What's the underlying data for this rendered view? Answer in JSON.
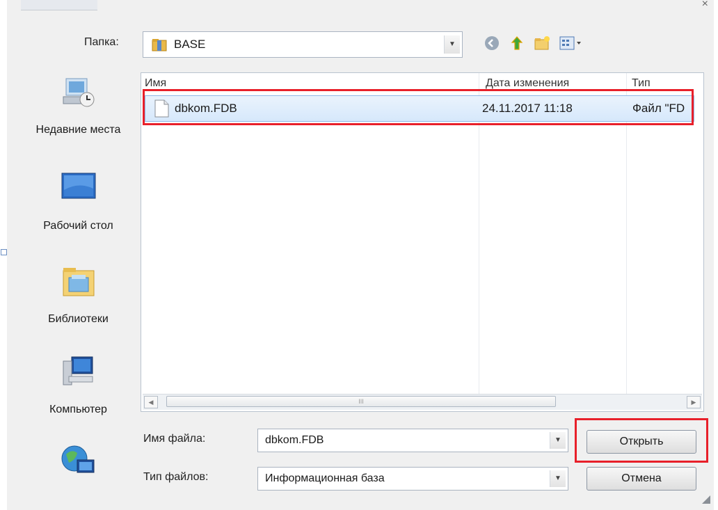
{
  "dialog": {
    "folder_label": "Папка:",
    "current_folder": "BASE",
    "places": [
      {
        "label": "Недавние места",
        "icon": "recent-places-icon"
      },
      {
        "label": "Рабочий стол",
        "icon": "desktop-icon"
      },
      {
        "label": "Библиотеки",
        "icon": "libraries-icon"
      },
      {
        "label": "Компьютер",
        "icon": "computer-icon"
      },
      {
        "label": "",
        "icon": "network-icon"
      }
    ],
    "columns": {
      "name": "Имя",
      "date": "Дата изменения",
      "type": "Тип"
    },
    "files": [
      {
        "name": "dbkom.FDB",
        "date": "24.11.2017 11:18",
        "type": "Файл \"FD"
      }
    ],
    "filename_label": "Имя файла:",
    "filename_value": "dbkom.FDB",
    "filetype_label": "Тип файлов:",
    "filetype_value": "Информационная база",
    "open_button": "Открыть",
    "cancel_button": "Отмена",
    "scroll_marker": "III"
  },
  "colors": {
    "highlight": "#e8202a",
    "selection": "#d6e8fb"
  }
}
